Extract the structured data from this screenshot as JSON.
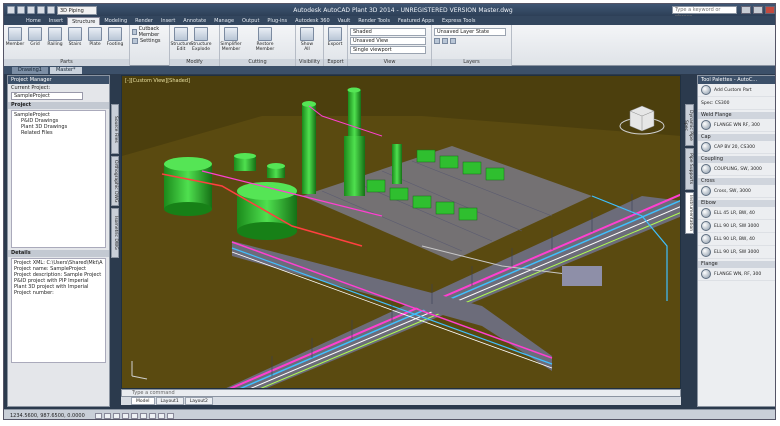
{
  "app": {
    "title": "Autodesk AutoCAD Plant 3D 2014 - UNREGISTERED VERSION   Master.dwg",
    "workspace": "3D Piping",
    "search_placeholder": "Type a keyword or phrase"
  },
  "ribbon": {
    "tabs": [
      "Home",
      "Insert",
      "Structure",
      "Modeling",
      "Render",
      "Insert",
      "Annotate",
      "Manage",
      "Output",
      "Plug-ins",
      "Autodesk 360",
      "Vault",
      "Render Tools",
      "Featured Apps",
      "Express Tools"
    ],
    "active_tab": "Structure",
    "panels": [
      {
        "title": "Parts",
        "buttons": [
          "Member",
          "Grid",
          "Railing",
          "Stairs",
          "Plate",
          "Footing",
          "Ladder"
        ]
      },
      {
        "title": "",
        "list": [
          "Cutback Member",
          "Settings"
        ]
      },
      {
        "title": "Modify",
        "buttons": [
          "Structure Edit",
          "Structure Explode"
        ]
      },
      {
        "title": "Cutting",
        "buttons": [
          "Simplifier Member",
          "Restore Member"
        ]
      },
      {
        "title": "Visibility",
        "buttons": [
          "Show All"
        ]
      },
      {
        "title": "Export",
        "buttons": [
          "Export"
        ]
      },
      {
        "title": "View",
        "list": [
          "Shaded",
          "Unsaved View",
          "Single viewport"
        ]
      },
      {
        "title": "Layers",
        "list": [
          "Unsaved Layer State"
        ]
      }
    ]
  },
  "doc_tabs": [
    "Drawing1",
    "Master*"
  ],
  "project_manager": {
    "title": "Project Manager",
    "current_project_label": "Current Project:",
    "current_project": "SampleProject",
    "project_section": "Project",
    "tree": [
      "SampleProject",
      "P&ID Drawings",
      "Plant 3D Drawings",
      "Related Files"
    ],
    "details_section": "Details",
    "details": [
      "Project XML: C:\\Users\\Shared\\Mkt\\Apps",
      "Project name: SampleProject",
      "Project description: Sample Project",
      "P&ID project with PIP Imperial",
      "Plant 3D project with Imperial",
      "Project number:"
    ],
    "vtabs": [
      "Source Files",
      "Orthographic DWG",
      "Isometric DWG"
    ]
  },
  "viewport": {
    "label": "[-][Custom View][Shaded]"
  },
  "command_line": {
    "placeholder": "Type a command"
  },
  "layout_tabs": [
    "Model",
    "Layout1",
    "Layout2"
  ],
  "statusbar": {
    "coords": "1234.5600, 987.6500, 0.0000"
  },
  "tool_palettes": {
    "title": "Tool Palettes - AutoC...",
    "vtabs": [
      "Dynamic Pipe Spec",
      "Pipe Supports",
      "Instrumentation"
    ],
    "sections": [
      {
        "title": "",
        "items": [
          "Add Custom Part",
          "Spec: CS300"
        ]
      },
      {
        "title": "Weld Flange",
        "items": [
          "FLANGE WN RF, 300"
        ]
      },
      {
        "title": "Cap",
        "items": [
          "CAP BV 20, CS300"
        ]
      },
      {
        "title": "Coupling",
        "items": [
          "COUPLING, SW, 3000"
        ]
      },
      {
        "title": "Cross",
        "items": [
          "Cross, SW, 3000"
        ]
      },
      {
        "title": "Elbow",
        "items": [
          "ELL 45 LR, BW, 40",
          "ELL 90 LR, SW 3000",
          "ELL 90 LR, BW, 40",
          "ELL 90 LR, SW 3000"
        ]
      },
      {
        "title": "Flange",
        "items": [
          "FLANGE WN, RF, 300"
        ]
      }
    ]
  }
}
